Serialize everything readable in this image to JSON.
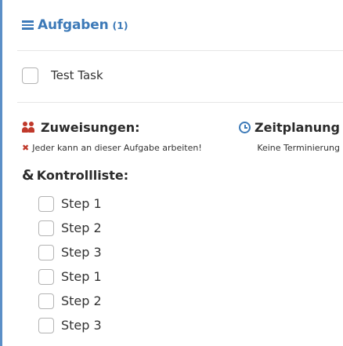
{
  "header": {
    "title": "Aufgaben",
    "count": "(1)"
  },
  "task": {
    "label": "Test Task",
    "checked": false
  },
  "assignments": {
    "title": "Zuweisungen:",
    "detail": "Jeder kann an dieser Aufgabe arbeiten!",
    "icon": "users-icon",
    "icon_color": "#c0392b"
  },
  "scheduling": {
    "title": "Zeitplanung",
    "detail": "Keine Terminierung",
    "icon": "clock-icon",
    "icon_color": "#3d7ab8"
  },
  "checklist": {
    "title": "Kontrollliste:",
    "items": [
      {
        "label": "Step 1",
        "checked": false
      },
      {
        "label": "Step 2",
        "checked": false
      },
      {
        "label": "Step 3",
        "checked": false
      },
      {
        "label": "Step 1",
        "checked": false
      },
      {
        "label": "Step 2",
        "checked": false
      },
      {
        "label": "Step 3",
        "checked": false
      }
    ]
  },
  "colors": {
    "accent": "#3d7ab8",
    "danger": "#c0392b"
  }
}
